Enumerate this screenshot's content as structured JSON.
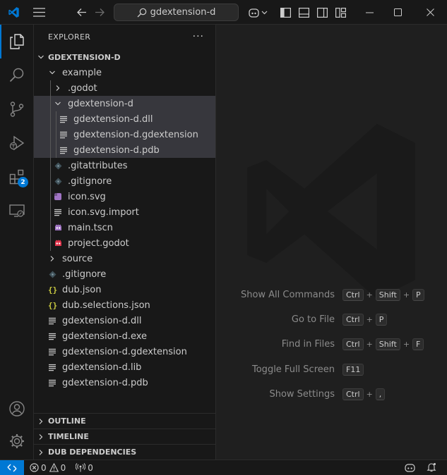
{
  "titlebar": {
    "search_text": "gdextension-d"
  },
  "explorer": {
    "header": "EXPLORER",
    "more": "···",
    "root": "GDEXTENSION-D",
    "tree": [
      {
        "label": "example",
        "type": "folder-open",
        "depth": 1
      },
      {
        "label": ".godot",
        "type": "folder-closed",
        "depth": 2
      },
      {
        "label": "gdextension-d",
        "type": "folder-open",
        "depth": 2,
        "selected": true
      },
      {
        "label": "gdextension-d.dll",
        "type": "lines",
        "depth": 3,
        "selected": true
      },
      {
        "label": "gdextension-d.gdextension",
        "type": "lines",
        "depth": 3,
        "selected": true
      },
      {
        "label": "gdextension-d.pdb",
        "type": "lines",
        "depth": 3,
        "selected": true
      },
      {
        "label": ".gitattributes",
        "type": "git",
        "depth": 2
      },
      {
        "label": ".gitignore",
        "type": "git",
        "depth": 2
      },
      {
        "label": "icon.svg",
        "type": "svg",
        "depth": 2
      },
      {
        "label": "icon.svg.import",
        "type": "lines",
        "depth": 2
      },
      {
        "label": "main.tscn",
        "type": "godot-purple",
        "depth": 2
      },
      {
        "label": "project.godot",
        "type": "godot-red",
        "depth": 2
      },
      {
        "label": "source",
        "type": "folder-closed",
        "depth": 1
      },
      {
        "label": ".gitignore",
        "type": "git",
        "depth": 1
      },
      {
        "label": "dub.json",
        "type": "json",
        "depth": 1
      },
      {
        "label": "dub.selections.json",
        "type": "json",
        "depth": 1
      },
      {
        "label": "gdextension-d.dll",
        "type": "lines",
        "depth": 1
      },
      {
        "label": "gdextension-d.exe",
        "type": "lines",
        "depth": 1
      },
      {
        "label": "gdextension-d.gdextension",
        "type": "lines",
        "depth": 1
      },
      {
        "label": "gdextension-d.lib",
        "type": "lines",
        "depth": 1
      },
      {
        "label": "gdextension-d.pdb",
        "type": "lines",
        "depth": 1
      }
    ],
    "sections": [
      "OUTLINE",
      "TIMELINE",
      "DUB DEPENDENCIES"
    ]
  },
  "activity": {
    "extensions_badge": "2"
  },
  "editor": {
    "hints": [
      {
        "label": "Show All Commands",
        "keys": [
          "Ctrl",
          "Shift",
          "P"
        ]
      },
      {
        "label": "Go to File",
        "keys": [
          "Ctrl",
          "P"
        ]
      },
      {
        "label": "Find in Files",
        "keys": [
          "Ctrl",
          "Shift",
          "F"
        ]
      },
      {
        "label": "Toggle Full Screen",
        "keys": [
          "F11"
        ]
      },
      {
        "label": "Show Settings",
        "keys": [
          "Ctrl",
          ","
        ]
      }
    ],
    "plus": "+"
  },
  "statusbar": {
    "errors": "0",
    "warnings": "0",
    "ports": "0"
  },
  "colors": {
    "accent": "#0078d4",
    "folder_chevron": "#cccccc",
    "json": "#cbcb41",
    "svg": "#a074c4",
    "godot_purple": "#a074c4",
    "godot_red": "#e0334b",
    "git": "#41535b"
  }
}
